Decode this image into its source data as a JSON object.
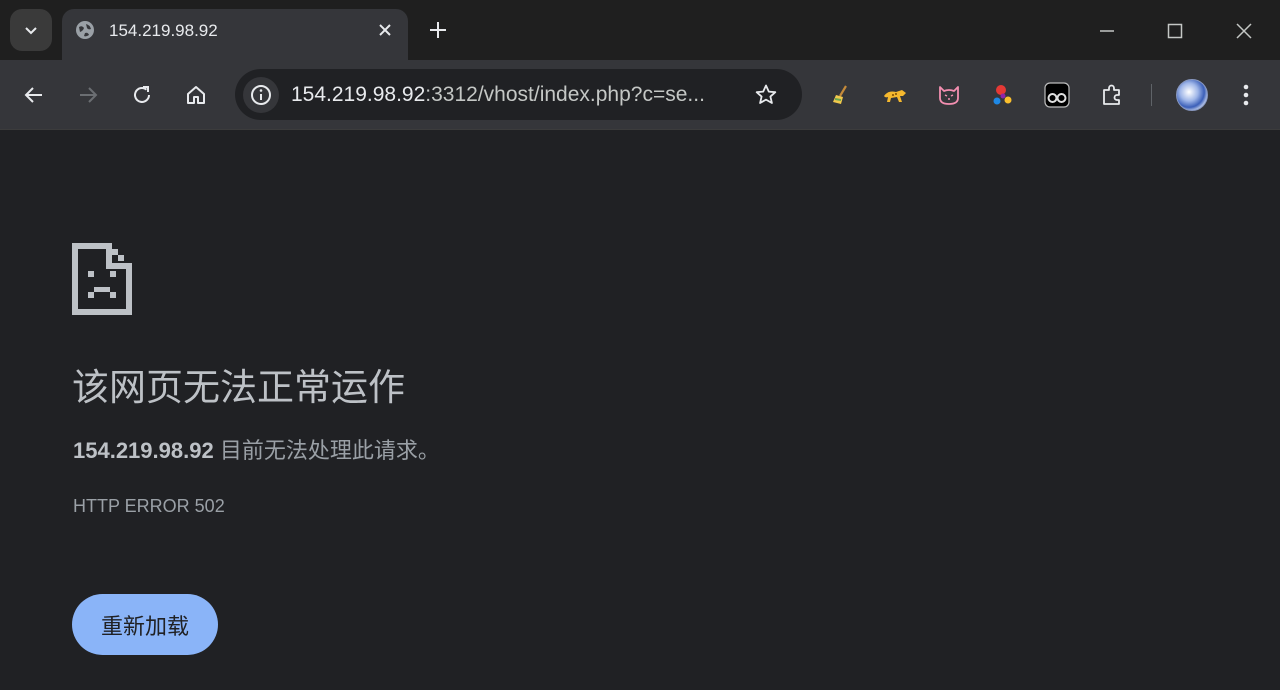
{
  "tab": {
    "title": "154.219.98.92",
    "favicon": "globe-icon"
  },
  "omnibox": {
    "url_host": "154.219.98.92",
    "url_rest": ":3312/vhost/index.php?c=se..."
  },
  "extensions": [
    {
      "name": "broom-extension-icon",
      "glyph": "🧹"
    },
    {
      "name": "cheetah-extension-icon",
      "glyph": "🐆"
    },
    {
      "name": "cat-extension-icon",
      "glyph": "🐱"
    },
    {
      "name": "molecule-extension-icon",
      "glyph": "⚛"
    },
    {
      "name": "tampermonkey-extension-icon",
      "glyph": "◉"
    }
  ],
  "error": {
    "title": "该网页无法正常运作",
    "host": "154.219.98.92",
    "message": " 目前无法处理此请求。",
    "code": "HTTP ERROR 502",
    "reload_label": "重新加载"
  },
  "colors": {
    "background": "#202124",
    "toolbar": "#35363a",
    "button": "#8ab4f8"
  }
}
